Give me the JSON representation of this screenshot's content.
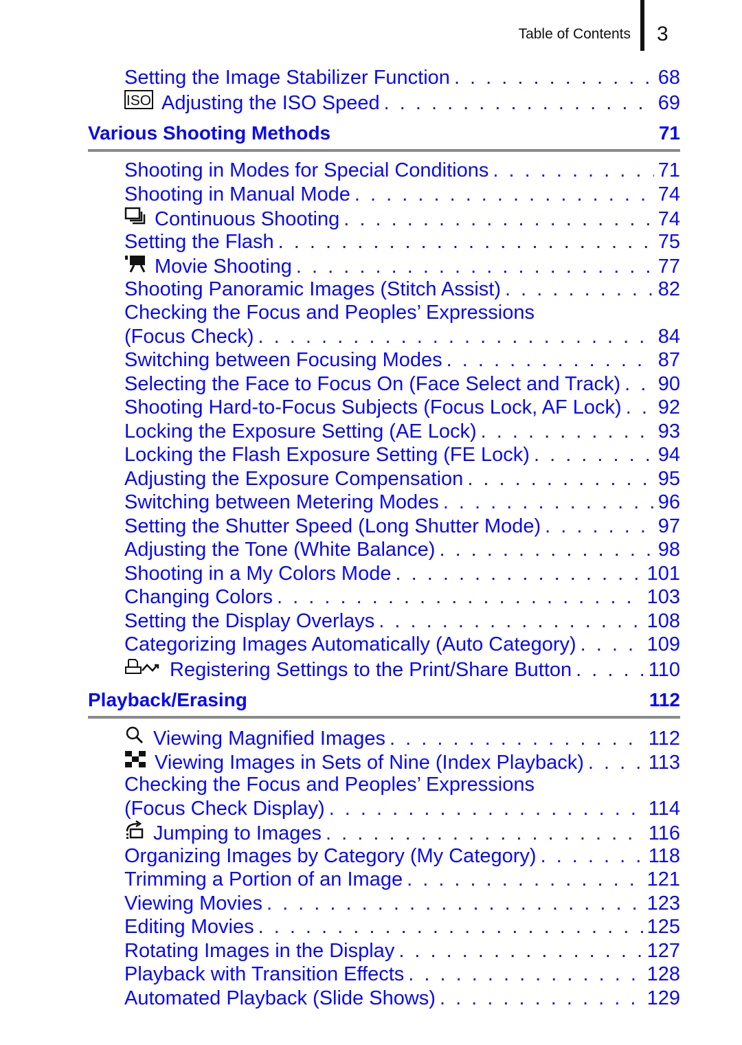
{
  "header": {
    "title": "Table of Contents",
    "page": "3"
  },
  "colors": {
    "link": "#0a0af0",
    "rule": "#8a8a8a",
    "header_text": "#111111"
  },
  "toc": {
    "pre": [
      {
        "title": "Setting the Image Stabilizer Function",
        "page": "68",
        "icon": null
      },
      {
        "title": "Adjusting the ISO Speed",
        "page": "69",
        "icon": "iso-icon"
      }
    ],
    "sections": [
      {
        "title": "Various Shooting Methods",
        "page": "71",
        "entries": [
          {
            "title": "Shooting in Modes for Special Conditions",
            "page": "71",
            "icon": null
          },
          {
            "title": "Shooting in Manual Mode",
            "page": "74",
            "icon": null
          },
          {
            "title": "Continuous Shooting",
            "page": "74",
            "icon": "continuous-shooting-icon"
          },
          {
            "title": "Setting the Flash",
            "page": "75",
            "icon": null
          },
          {
            "title": "Movie Shooting",
            "page": "77",
            "icon": "movie-camera-icon"
          },
          {
            "title": "Shooting Panoramic Images (Stitch Assist)",
            "page": "82",
            "icon": null
          },
          {
            "title": "Checking the Focus and Peoples’ Expressions",
            "continuation": "(Focus Check)",
            "page": "84",
            "icon": null
          },
          {
            "title": "Switching between Focusing Modes",
            "page": "87",
            "icon": null
          },
          {
            "title": "Selecting the Face to Focus On (Face Select and Track)",
            "page": "90",
            "icon": null
          },
          {
            "title": "Shooting Hard-to-Focus Subjects (Focus Lock, AF Lock)",
            "page": "92",
            "icon": null
          },
          {
            "title": "Locking the Exposure Setting (AE Lock)",
            "page": "93",
            "icon": null
          },
          {
            "title": "Locking the Flash Exposure Setting (FE Lock)",
            "page": "94",
            "icon": null
          },
          {
            "title": "Adjusting the Exposure Compensation",
            "page": "95",
            "icon": null
          },
          {
            "title": "Switching between Metering Modes",
            "page": "96",
            "icon": null
          },
          {
            "title": "Setting the Shutter Speed (Long Shutter Mode)",
            "page": "97",
            "icon": null
          },
          {
            "title": "Adjusting the Tone (White Balance)",
            "page": "98",
            "icon": null
          },
          {
            "title": "Shooting in a My Colors Mode",
            "page": "101",
            "icon": null
          },
          {
            "title": "Changing Colors",
            "page": "103",
            "icon": null
          },
          {
            "title": "Setting the Display Overlays",
            "page": "108",
            "icon": null
          },
          {
            "title": "Categorizing Images Automatically (Auto Category)",
            "page": "109",
            "icon": null
          },
          {
            "title": "Registering Settings to the Print/Share Button",
            "page": "110",
            "icon": "print-share-icon"
          }
        ]
      },
      {
        "title": "Playback/Erasing",
        "page": "112",
        "entries": [
          {
            "title": "Viewing Magnified Images",
            "page": "112",
            "icon": "magnify-icon"
          },
          {
            "title": "Viewing Images in Sets of Nine (Index Playback)",
            "page": "113",
            "icon": "index-grid-icon"
          },
          {
            "title": "Checking the Focus and Peoples’ Expressions",
            "continuation": "(Focus Check Display)",
            "page": "114",
            "icon": null
          },
          {
            "title": "Jumping to Images",
            "page": "116",
            "icon": "jump-icon"
          },
          {
            "title": "Organizing Images by Category (My Category)",
            "page": "118",
            "icon": null
          },
          {
            "title": "Trimming a Portion of an Image",
            "page": "121",
            "icon": null
          },
          {
            "title": "Viewing Movies",
            "page": "123",
            "icon": null
          },
          {
            "title": "Editing Movies",
            "page": "125",
            "icon": null
          },
          {
            "title": "Rotating Images in the Display",
            "page": "127",
            "icon": null
          },
          {
            "title": "Playback with Transition Effects",
            "page": "128",
            "icon": null
          },
          {
            "title": "Automated Playback (Slide Shows)",
            "page": "129",
            "icon": null
          }
        ]
      }
    ]
  }
}
